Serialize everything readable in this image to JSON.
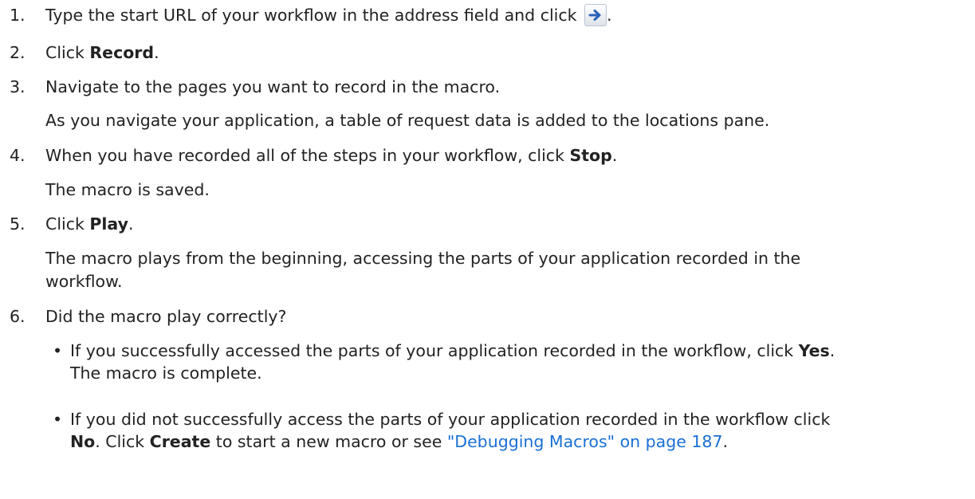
{
  "steps": [
    {
      "number": "1.",
      "text": "Type the start URL of your workflow in the address field and click",
      "icon": "go-arrow-icon",
      "after": "."
    },
    {
      "number": "2.",
      "prefix": "Click ",
      "bold": "Record",
      "suffix": "."
    },
    {
      "number": "3.",
      "text": "Navigate to the pages you want to record in the macro.",
      "note": "As you navigate your application, a table of request data is added to the locations pane."
    },
    {
      "number": "4.",
      "prefix": "When you have recorded all of the steps in your workflow, click ",
      "bold": "Stop",
      "suffix": ".",
      "note": "The macro is saved."
    },
    {
      "number": "5.",
      "prefix": "Click ",
      "bold": "Play",
      "suffix": ".",
      "note_line1": "The macro plays from the beginning, accessing the parts of your application recorded in the",
      "note_line2": "workflow."
    },
    {
      "number": "6.",
      "text": "Did the macro play correctly?",
      "bullets": [
        {
          "line1_prefix": "If you successfully accessed the parts of your application recorded in the workflow, click ",
          "line1_bold": "Yes",
          "line1_suffix": ".",
          "line2": "The macro is complete."
        },
        {
          "line1": "If you did not successfully access the parts of your application recorded in the workflow click",
          "line2_bold1": "No",
          "line2_mid": ". Click ",
          "line2_bold2": "Create",
          "line2_after": " to start a new macro or see ",
          "link": "\"Debugging Macros\" on page 187",
          "line2_end": "."
        }
      ]
    }
  ],
  "colors": {
    "text": "#222222",
    "link": "#1a6fd4",
    "icon_arrow": "#2b63b8"
  },
  "bullet_glyph": "•"
}
